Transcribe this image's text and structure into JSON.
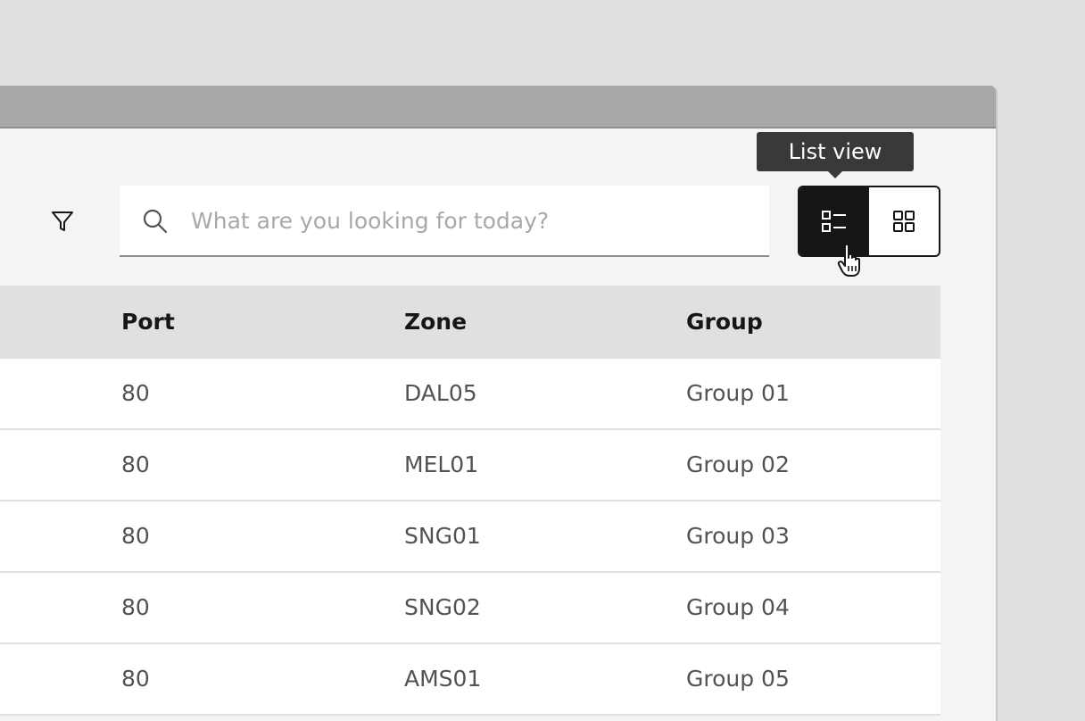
{
  "search": {
    "placeholder": "What are you looking for today?"
  },
  "view_switcher": {
    "tooltip": "List view",
    "active": "list",
    "options": [
      "list-view",
      "grid-view"
    ]
  },
  "table": {
    "columns": [
      "Port",
      "Zone",
      "Group"
    ],
    "rows": [
      [
        "80",
        "DAL05",
        "Group 01"
      ],
      [
        "80",
        "MEL01",
        "Group 02"
      ],
      [
        "80",
        "SNG01",
        "Group 03"
      ],
      [
        "80",
        "SNG02",
        "Group 04"
      ],
      [
        "80",
        "AMS01",
        "Group 05"
      ]
    ]
  },
  "colors": {
    "background": "#e0e0e0",
    "titlebar": "#a8a8a8",
    "panel": "#f4f4f4",
    "active_toggle": "#161616",
    "tooltip": "#393939"
  }
}
